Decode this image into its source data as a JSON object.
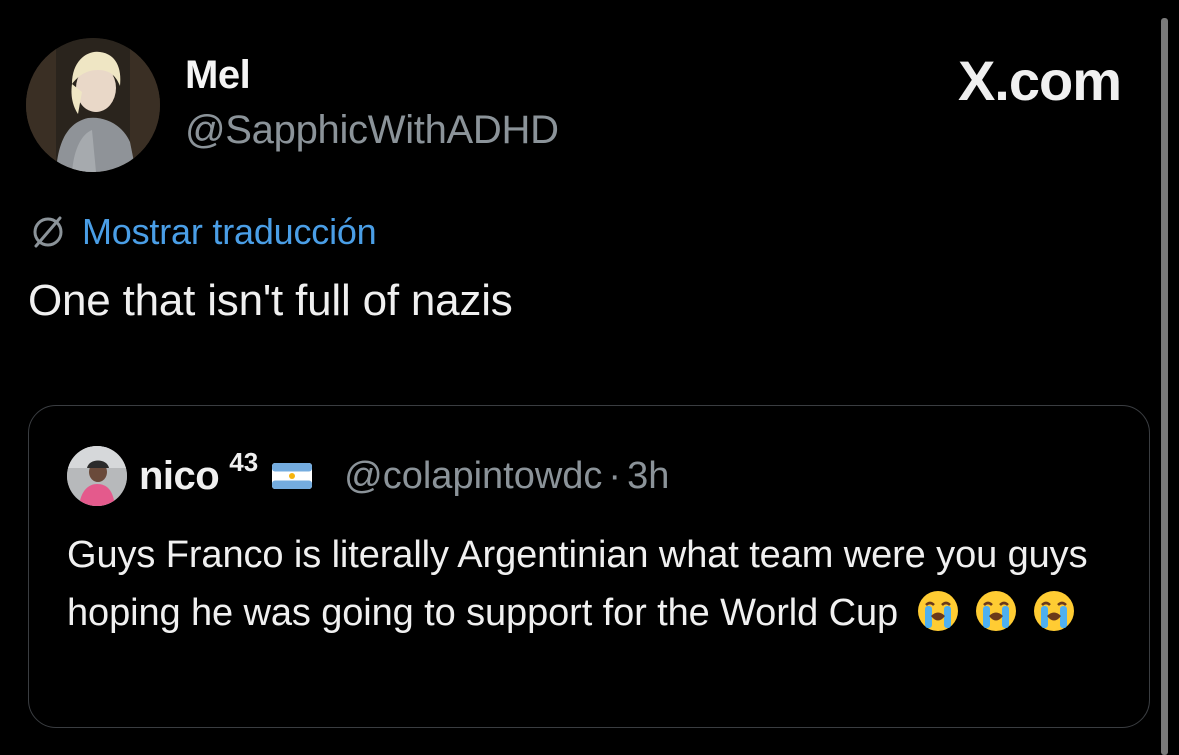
{
  "tweet": {
    "display_name": "Mel",
    "handle": "@SapphicWithADHD",
    "brand": "X.com",
    "translate_label": "Mostrar traducción",
    "text": "One that isn't full of nazis"
  },
  "quote": {
    "display_name": "nico",
    "name_superscript": "43",
    "handle": "@colapintowdc",
    "separator": "·",
    "time": "3h",
    "text": "Guys Franco is literally Argentinian what team were you guys hoping he was going to support for the World Cup",
    "emojis": [
      "loudly-crying-face",
      "loudly-crying-face",
      "loudly-crying-face"
    ]
  },
  "icons": {
    "translate": "translate-icon",
    "flag": "argentina-flag-icon"
  },
  "colors": {
    "background": "#000000",
    "link": "#4a9ee6",
    "secondary_text": "#8b9399",
    "card_border": "#3a3d41"
  }
}
